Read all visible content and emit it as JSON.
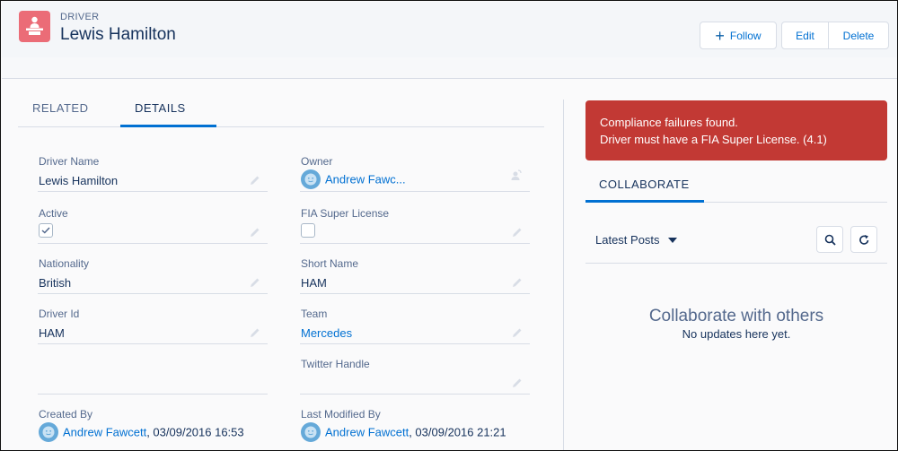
{
  "header": {
    "object_type": "DRIVER",
    "title": "Lewis Hamilton",
    "object_icon": "driver-podium-icon",
    "icon_color": "#eb6c77",
    "actions": {
      "follow_label": "Follow",
      "edit_label": "Edit",
      "delete_label": "Delete"
    }
  },
  "tabs": [
    {
      "label": "RELATED",
      "active": false
    },
    {
      "label": "DETAILS",
      "active": true
    }
  ],
  "details": {
    "left": [
      {
        "label": "Driver Name",
        "value": "Lewis Hamilton",
        "type": "text"
      },
      {
        "label": "Active",
        "value": true,
        "type": "checkbox"
      },
      {
        "label": "Nationality",
        "value": "British",
        "type": "text"
      },
      {
        "label": "Driver Id",
        "value": "HAM",
        "type": "text"
      }
    ],
    "right": [
      {
        "label": "Owner",
        "value": "Andrew Fawc...",
        "type": "user-link"
      },
      {
        "label": "FIA Super License",
        "value": false,
        "type": "checkbox"
      },
      {
        "label": "Short Name",
        "value": "HAM",
        "type": "text"
      },
      {
        "label": "Team",
        "value": "Mercedes",
        "type": "link"
      },
      {
        "label": "Twitter Handle",
        "value": "",
        "type": "text"
      }
    ],
    "created_by": {
      "label": "Created By",
      "user": "Andrew Fawcett",
      "timestamp": ", 03/09/2016 16:53"
    },
    "last_modified_by": {
      "label": "Last Modified By",
      "user": "Andrew Fawcett",
      "timestamp": ", 03/09/2016 21:21"
    }
  },
  "alert": {
    "line1": "Compliance failures found.",
    "line2": "Driver must have a FIA Super License. (4.1)",
    "color": "#c23934"
  },
  "collaborate": {
    "tab_label": "COLLABORATE",
    "feed_filter": "Latest Posts",
    "empty_title": "Collaborate with others",
    "empty_subtitle": "No updates here yet."
  },
  "colors": {
    "accent": "#0070d2",
    "text": "#16325c",
    "label": "#54698d"
  }
}
